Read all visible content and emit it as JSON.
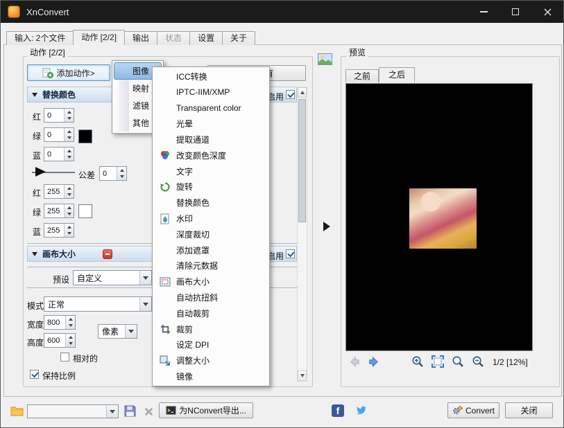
{
  "titlebar": {
    "title": "XnConvert"
  },
  "tabs": [
    {
      "label": "输入: 2个文件"
    },
    {
      "label": "动作 [2/2]"
    },
    {
      "label": "输出"
    },
    {
      "label": "状态"
    },
    {
      "label": "设置"
    },
    {
      "label": "关于"
    }
  ],
  "actions_panel": {
    "title": "动作 [2/2]",
    "add_action": "添加动作>",
    "delete_all": "删除所有",
    "enable_label": "启用",
    "replace_color": {
      "title": "替换颜色",
      "r1_label": "红",
      "r1": "0",
      "g1_label": "绿",
      "g1": "0",
      "b1_label": "蓝",
      "b1": "0",
      "tolerance_label": "公差",
      "tolerance": "0",
      "r2_label": "红",
      "r2": "255",
      "g2_label": "绿",
      "g2": "255",
      "b2_label": "蓝",
      "b2": "255",
      "color1": "#000000",
      "color2": "#ffffff"
    },
    "canvas_size": {
      "title": "画布大小",
      "preset_label": "预设",
      "preset": "自定义",
      "mode_label": "模式",
      "mode": "正常",
      "width_label": "宽度",
      "width": "800",
      "height_label": "高度",
      "height": "600",
      "unit": "像素",
      "relative": "相对的",
      "keep_ratio": "保持比例"
    }
  },
  "menu": [
    {
      "label": "图像",
      "highlighted": true
    },
    {
      "label": "映射"
    },
    {
      "label": "滤镜"
    },
    {
      "label": "其他"
    }
  ],
  "submenu": [
    "ICC转换",
    "IPTC-IIM/XMP",
    "Transparent color",
    "光晕",
    "提取通道",
    "改变颜色深度",
    "文字",
    "旋转",
    "替换颜色",
    "水印",
    "深度裁切",
    "添加遮罩",
    "清除元数据",
    "画布大小",
    "自动抗扭斜",
    "自动裁剪",
    "裁剪",
    "设定 DPI",
    "调整大小",
    "镜像"
  ],
  "preview": {
    "title": "预览",
    "tab_before": "之前",
    "tab_after": "之后",
    "page_info": "1/2 [12%]"
  },
  "bottombar": {
    "export": "为NConvert导出...",
    "convert": "Convert",
    "close": "关闭",
    "facebook_glyph": "f"
  },
  "colors": {
    "titlebar": "#1b1b1b",
    "accent_blue": "#2f7bd6",
    "menu_highlight": "#8cbae6",
    "section_header": "#cddded",
    "facebook": "#3b5998",
    "twitter": "#4aa8e8"
  }
}
